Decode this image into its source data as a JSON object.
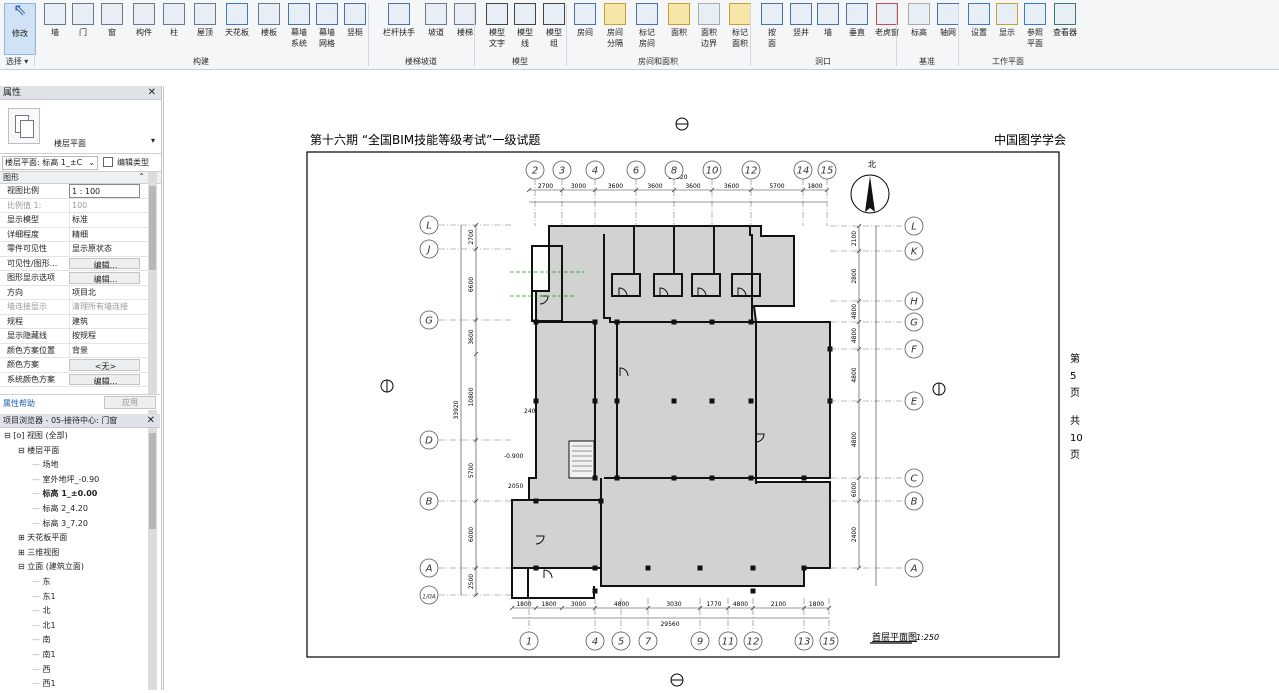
{
  "ribbon": {
    "tools": [
      {
        "label": "修改",
        "icon": "cursor-icon"
      },
      {
        "label": "墙",
        "icon": "wall-icon"
      },
      {
        "label": "门",
        "icon": "door-icon"
      },
      {
        "label": "窗",
        "icon": "window-icon"
      },
      {
        "label": "构件",
        "icon": "component-icon"
      },
      {
        "label": "柱",
        "icon": "column-icon"
      },
      {
        "label": "屋顶",
        "icon": "roof-icon"
      },
      {
        "label": "天花板",
        "icon": "ceiling-icon"
      },
      {
        "label": "楼板",
        "icon": "floor-icon"
      },
      {
        "label": "幕墙\n系统",
        "icon": "curtain-system-icon"
      },
      {
        "label": "幕墙\n网格",
        "icon": "curtain-grid-icon"
      },
      {
        "label": "竖梃",
        "icon": "mullion-icon"
      },
      {
        "label": "栏杆扶手",
        "icon": "railing-icon"
      },
      {
        "label": "坡道",
        "icon": "ramp-icon"
      },
      {
        "label": "楼梯",
        "icon": "stair-icon"
      },
      {
        "label": "模型\n文字",
        "icon": "model-text-icon"
      },
      {
        "label": "模型\n线",
        "icon": "model-line-icon"
      },
      {
        "label": "模型\n组",
        "icon": "model-group-icon"
      },
      {
        "label": "房间",
        "icon": "room-icon"
      },
      {
        "label": "房间\n分隔",
        "icon": "room-separator-icon"
      },
      {
        "label": "标记\n房间",
        "icon": "tag-room-icon"
      },
      {
        "label": "面积",
        "icon": "area-icon"
      },
      {
        "label": "面积\n边界",
        "icon": "area-boundary-icon"
      },
      {
        "label": "标记\n面积",
        "icon": "tag-area-icon"
      },
      {
        "label": "按\n面",
        "icon": "by-face-icon"
      },
      {
        "label": "竖井",
        "icon": "shaft-icon"
      },
      {
        "label": "墙",
        "icon": "wall-opening-icon"
      },
      {
        "label": "垂直",
        "icon": "vertical-opening-icon"
      },
      {
        "label": "老虎窗",
        "icon": "dormer-icon"
      },
      {
        "label": "标高",
        "icon": "level-icon"
      },
      {
        "label": "轴网",
        "icon": "grid-icon"
      },
      {
        "label": "设置",
        "icon": "set-workplane-icon"
      },
      {
        "label": "显示",
        "icon": "show-workplane-icon"
      },
      {
        "label": "参照\n平面",
        "icon": "ref-plane-icon"
      },
      {
        "label": "查看器",
        "icon": "viewer-icon"
      }
    ],
    "groups": [
      "选择",
      "构建",
      "楼梯坡道",
      "模型",
      "房间和面积",
      "洞口",
      "基准",
      "工作平面"
    ]
  },
  "properties": {
    "title": "属性",
    "type_name": "楼层平面",
    "view_selector": "楼层平面: 标高 1_±C",
    "edit_type": "编辑类型",
    "section": "图形",
    "rows": [
      {
        "k": "视图比例",
        "v": "1 : 100"
      },
      {
        "k": "比例值 1:",
        "v": "100"
      },
      {
        "k": "显示模型",
        "v": "标准"
      },
      {
        "k": "详细程度",
        "v": "精细"
      },
      {
        "k": "零件可见性",
        "v": "显示原状态"
      },
      {
        "k": "可见性/图形...",
        "v": "编辑..."
      },
      {
        "k": "图形显示选项",
        "v": "编辑..."
      },
      {
        "k": "方向",
        "v": "项目北"
      },
      {
        "k": "墙连接显示",
        "v": "清理所有墙连接"
      },
      {
        "k": "规程",
        "v": "建筑"
      },
      {
        "k": "显示隐藏线",
        "v": "按规程"
      },
      {
        "k": "颜色方案位置",
        "v": "背景"
      },
      {
        "k": "颜色方案",
        "v": "<无>"
      },
      {
        "k": "系统颜色方案",
        "v": "编辑..."
      }
    ],
    "help": "属性帮助",
    "apply": "应用"
  },
  "browser": {
    "title": "项目浏览器 - 05-接待中心: 门窗",
    "items": [
      {
        "label": "视图 (全部)",
        "level": 0,
        "toggle": "⊟"
      },
      {
        "label": "楼层平面",
        "level": 1,
        "toggle": "⊟"
      },
      {
        "label": "场地",
        "level": 2,
        "toggle": ""
      },
      {
        "label": "室外地坪_-0.90",
        "level": 2,
        "toggle": ""
      },
      {
        "label": "标高 1_±0.00",
        "level": 2,
        "toggle": "",
        "bold": true
      },
      {
        "label": "标高 2_4.20",
        "level": 2,
        "toggle": ""
      },
      {
        "label": "标高 3_7.20",
        "level": 2,
        "toggle": ""
      },
      {
        "label": "天花板平面",
        "level": 1,
        "toggle": "⊞"
      },
      {
        "label": "三维视图",
        "level": 1,
        "toggle": "⊞"
      },
      {
        "label": "立面 (建筑立面)",
        "level": 1,
        "toggle": "⊟"
      },
      {
        "label": "东",
        "level": 2,
        "toggle": ""
      },
      {
        "label": "东1",
        "level": 2,
        "toggle": ""
      },
      {
        "label": "北",
        "level": 2,
        "toggle": ""
      },
      {
        "label": "北1",
        "level": 2,
        "toggle": ""
      },
      {
        "label": "南",
        "level": 2,
        "toggle": ""
      },
      {
        "label": "南1",
        "level": 2,
        "toggle": ""
      },
      {
        "label": "西",
        "level": 2,
        "toggle": ""
      },
      {
        "label": "西1",
        "level": 2,
        "toggle": ""
      }
    ]
  },
  "drawing": {
    "header_left": "第十六期 “全国BIM技能等级考试”一级试题",
    "header_right": "中国图学学会",
    "side_page": [
      "第",
      "5",
      "页",
      "共",
      "10",
      "页"
    ],
    "plan_caption": "首层平面图",
    "plan_scale": "1:250",
    "top_axes": [
      "2",
      "3",
      "4",
      "6",
      "8",
      "10",
      "12",
      "14",
      "15"
    ],
    "bottom_axes": [
      "1",
      "4",
      "5",
      "7",
      "9",
      "11",
      "12",
      "13",
      "15"
    ],
    "left_axes": [
      "L",
      "J",
      "G",
      "D",
      "B",
      "A",
      "1/0A"
    ],
    "right_axes": [
      "L",
      "K",
      "H",
      "G",
      "F",
      "E",
      "C",
      "B",
      "A"
    ],
    "top_dims": [
      "2700",
      "3000",
      "3600",
      "3600",
      "3600",
      "3600",
      "5700",
      "1800"
    ],
    "top_total": "27320",
    "bottom_dims": [
      "1800",
      "1800",
      "3000",
      "4800",
      "3030",
      "1770",
      "4800",
      "2100",
      "1800"
    ],
    "bottom_total": "29560",
    "left_dims": [
      "2700",
      "6600",
      "3600",
      "10800",
      "5700",
      "6000",
      "2500"
    ],
    "left_total": "33920",
    "right_dims": [
      "2100",
      "2800",
      "4800",
      "4800",
      "4800",
      "4800",
      "6000",
      "2400"
    ],
    "level_mark": "-0.900",
    "dim_2050": "2050",
    "dim_240": "240",
    "north_label": "北"
  }
}
